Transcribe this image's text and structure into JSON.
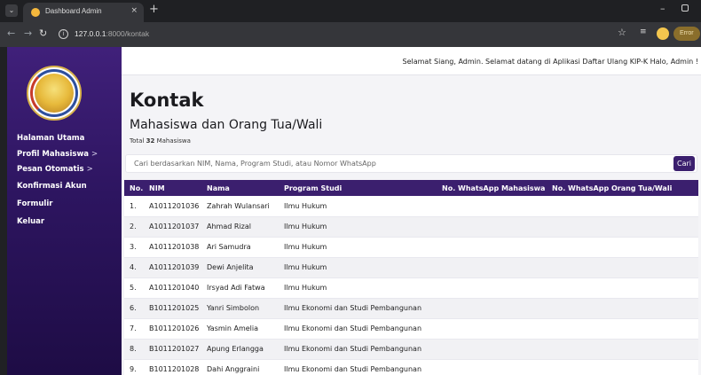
{
  "browser": {
    "tab_title": "Dashboard Admin",
    "tab_close": "×",
    "new_tab": "+",
    "url_host": "127.0.0.1",
    "url_path": ":8000/kontak",
    "error_label": "Error"
  },
  "sidebar": {
    "items": [
      {
        "label": "Halaman Utama",
        "chevron": ""
      },
      {
        "label": "Profil Mahasiswa",
        "chevron": ">"
      },
      {
        "label": "Pesan Otomatis",
        "chevron": ">"
      },
      {
        "label": "Konfirmasi Akun",
        "chevron": ""
      },
      {
        "label": "Formulir",
        "chevron": ""
      },
      {
        "label": "Keluar",
        "chevron": ""
      }
    ]
  },
  "topbar": {
    "greeting": "Selamat Siang, Admin. Selamat datang di Aplikasi Daftar Ulang KIP-K Halo, Admin !"
  },
  "page": {
    "title": "Kontak",
    "subtitle": "Mahasiswa dan Orang Tua/Wali",
    "total_prefix": "Total",
    "total_count": "32",
    "total_suffix": "Mahasiswa"
  },
  "search": {
    "placeholder": "Cari berdasarkan NIM, Nama, Program Studi, atau Nomor WhatsApp",
    "value": "",
    "button_label": "Cari"
  },
  "table": {
    "headers": [
      "No.",
      "NIM",
      "Nama",
      "Program Studi",
      "No. WhatsApp Mahasiswa",
      "No. WhatsApp Orang Tua/Wali"
    ],
    "rows": [
      [
        "1.",
        "A1011201036",
        "Zahrah Wulansari",
        "Ilmu Hukum",
        "",
        ""
      ],
      [
        "2.",
        "A1011201037",
        "Ahmad Rizal",
        "Ilmu Hukum",
        "",
        ""
      ],
      [
        "3.",
        "A1011201038",
        "Ari Samudra",
        "Ilmu Hukum",
        "",
        ""
      ],
      [
        "4.",
        "A1011201039",
        "Dewi Anjelita",
        "Ilmu Hukum",
        "",
        ""
      ],
      [
        "5.",
        "A1011201040",
        "Irsyad Adi Fatwa",
        "Ilmu Hukum",
        "",
        ""
      ],
      [
        "6.",
        "B1011201025",
        "Yanri Simbolon",
        "Ilmu Ekonomi dan Studi Pembangunan",
        "",
        ""
      ],
      [
        "7.",
        "B1011201026",
        "Yasmin Amelia",
        "Ilmu Ekonomi dan Studi Pembangunan",
        "",
        ""
      ],
      [
        "8.",
        "B1011201027",
        "Apung Erlangga",
        "Ilmu Ekonomi dan Studi Pembangunan",
        "",
        ""
      ],
      [
        "9.",
        "B1011201028",
        "Dahi Anggraini",
        "Ilmu Ekonomi dan Studi Pembangunan",
        "",
        ""
      ]
    ]
  },
  "colors": {
    "sidebar_top": "#40207a",
    "sidebar_bottom": "#1e0c45",
    "accent": "#3b1f6e",
    "content_bg": "#f4f4f7"
  }
}
